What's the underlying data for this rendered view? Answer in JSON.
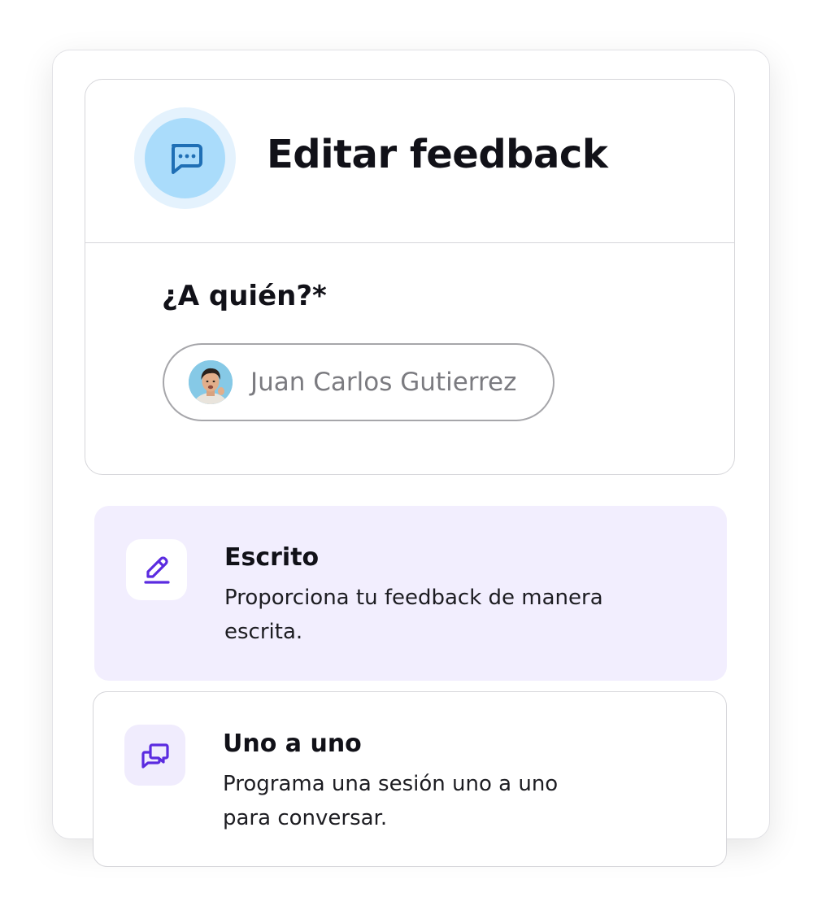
{
  "header": {
    "title": "Editar feedback",
    "icon": "chat-bubble-dots-icon",
    "accent_color": "#1f6fb5"
  },
  "recipient": {
    "label": "¿A quién?*",
    "selected_name": "Juan Carlos Gutierrez"
  },
  "options": [
    {
      "title": "Escrito",
      "description_line1": "Proporciona tu feedback de manera",
      "description_line2": "escrita.",
      "icon": "pencil-icon",
      "selected": true
    },
    {
      "title": "Uno a uno",
      "description_line1": "Programa una sesión uno a uno",
      "description_line2": "para conversar.",
      "icon": "conversation-icon",
      "selected": false
    }
  ],
  "colors": {
    "selected_option_bg": "#f2eefe",
    "icon_purple": "#5b2be0"
  }
}
